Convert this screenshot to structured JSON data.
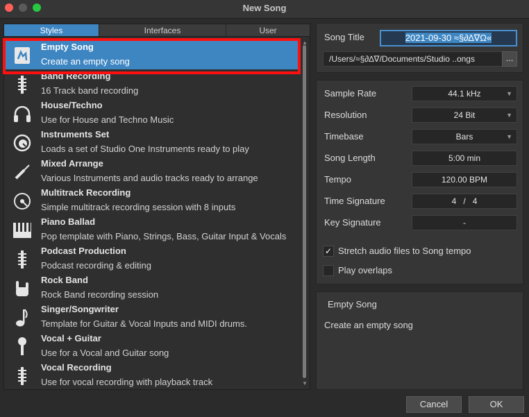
{
  "window": {
    "title": "New Song"
  },
  "tabs": [
    {
      "label": "Styles",
      "active": true
    },
    {
      "label": "Interfaces",
      "active": false
    },
    {
      "label": "User",
      "active": false
    }
  ],
  "templates": [
    {
      "name": "Empty Song",
      "desc": "Create an empty song",
      "icon": "empty-song-icon",
      "selected": true
    },
    {
      "name": "Band Recording",
      "desc": "16 Track band recording",
      "icon": "input-strip-icon"
    },
    {
      "name": "House/Techno",
      "desc": "Use for House and Techno Music",
      "icon": "headphones-icon"
    },
    {
      "name": "Instruments Set",
      "desc": "Loads a set of Studio One Instruments ready to play",
      "icon": "knob-icon"
    },
    {
      "name": "Mixed Arrange",
      "desc": "Various Instruments and audio tracks ready to arrange",
      "icon": "cable-icon"
    },
    {
      "name": "Multitrack Recording",
      "desc": "Simple multitrack recording session with 8 inputs",
      "icon": "disc-icon"
    },
    {
      "name": "Piano Ballad",
      "desc": "Pop template with Piano, Strings, Bass, Guitar Input & Vocals",
      "icon": "piano-keys-icon"
    },
    {
      "name": "Podcast Production",
      "desc": "Podcast recording & editing",
      "icon": "input-strip-icon"
    },
    {
      "name": "Rock Band",
      "desc": "Rock Band recording session",
      "icon": "rock-hand-icon"
    },
    {
      "name": "Singer/Songwriter",
      "desc": "Template for Guitar & Vocal Inputs and MIDI drums.",
      "icon": "music-note-icon"
    },
    {
      "name": "Vocal + Guitar",
      "desc": "Use for a Vocal and Guitar song",
      "icon": "microphone-icon"
    },
    {
      "name": "Vocal Recording",
      "desc": "Use for vocal recording with playback track",
      "icon": "input-strip-icon"
    }
  ],
  "song": {
    "title_label": "Song Title",
    "title_value": "2021-09-30 ≈§∂∆∇Ω«",
    "path_value": "/Users/≈§∂∆∇/Documents/Studio ..ongs",
    "browse_label": "..."
  },
  "settings": {
    "sample_rate_label": "Sample Rate",
    "sample_rate_value": "44.1 kHz",
    "resolution_label": "Resolution",
    "resolution_value": "24 Bit",
    "timebase_label": "Timebase",
    "timebase_value": "Bars",
    "song_length_label": "Song Length",
    "song_length_value": "5:00 min",
    "tempo_label": "Tempo",
    "tempo_value": "120.00 BPM",
    "time_signature_label": "Time Signature",
    "ts_numerator": "4",
    "ts_separator": "/",
    "ts_denominator": "4",
    "key_signature_label": "Key Signature",
    "key_signature_value": "-",
    "stretch_label": "Stretch audio files to Song tempo",
    "stretch_checked": true,
    "overlap_label": "Play overlaps",
    "overlap_checked": false
  },
  "info": {
    "title": "Empty Song",
    "desc": "Create an empty song"
  },
  "buttons": {
    "cancel": "Cancel",
    "ok": "OK"
  },
  "colors": {
    "accent": "#3e86c2",
    "highlight_box": "#ff1010"
  }
}
